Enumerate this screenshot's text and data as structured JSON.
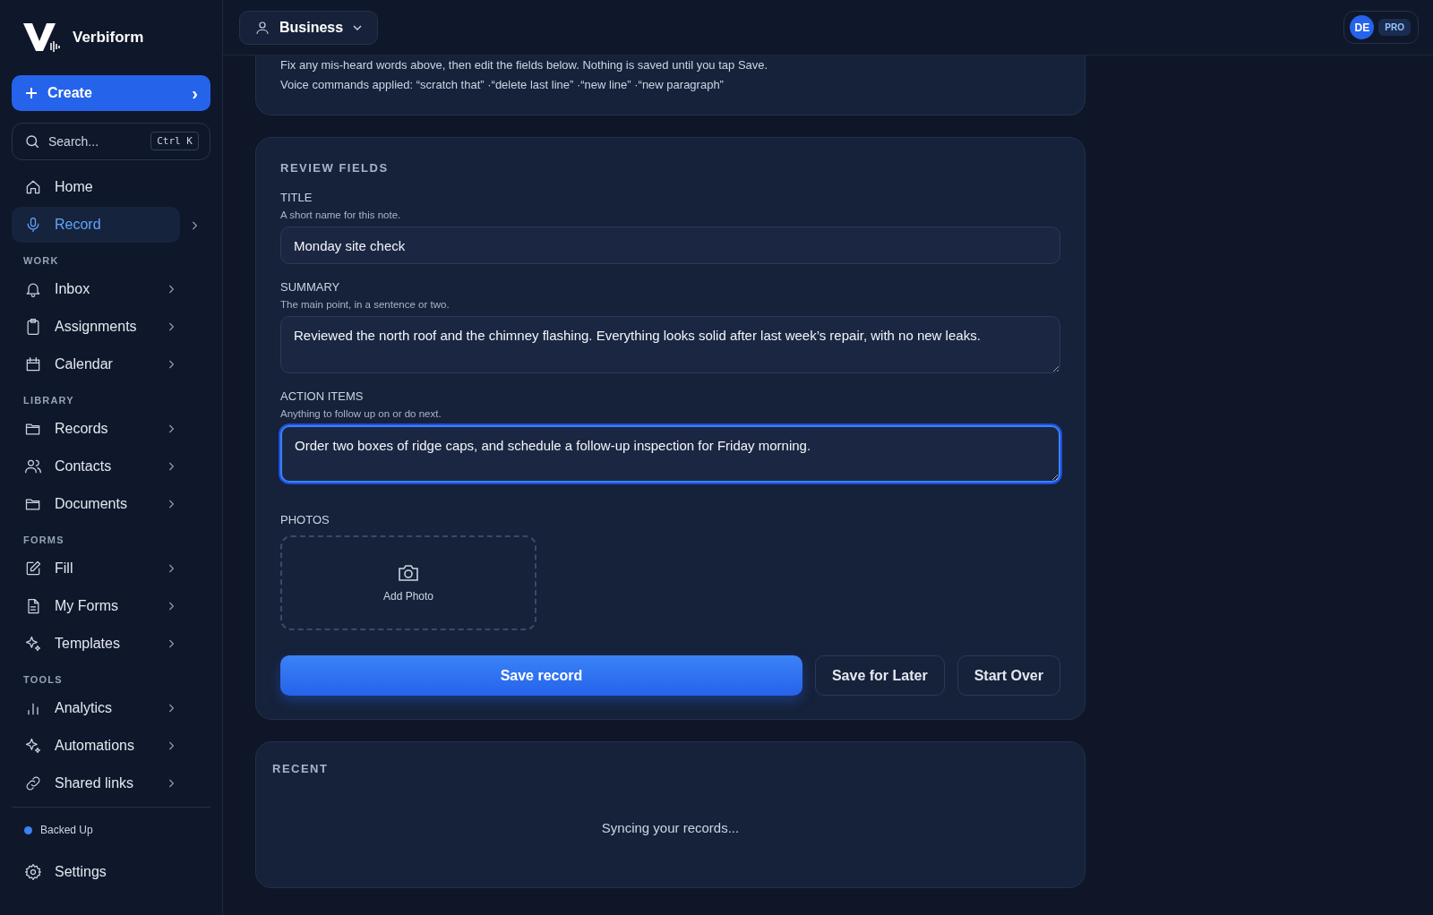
{
  "brand": {
    "name": "Verbiform"
  },
  "create_button": {
    "label": "Create",
    "chevron": "›"
  },
  "search": {
    "placeholder": "Search...",
    "shortcut": "Ctrl K"
  },
  "nav_top": [
    {
      "label": "Home",
      "selected": false,
      "chevron": false
    },
    {
      "label": "Record",
      "selected": true,
      "chevron": true
    }
  ],
  "nav_sections": [
    {
      "title": "WORK",
      "items": [
        {
          "label": "Inbox",
          "selected": false,
          "chevron": true
        },
        {
          "label": "Assignments",
          "selected": false,
          "chevron": true
        },
        {
          "label": "Calendar",
          "selected": false,
          "chevron": true
        }
      ]
    },
    {
      "title": "LIBRARY",
      "items": [
        {
          "label": "Records",
          "selected": false,
          "chevron": true
        },
        {
          "label": "Contacts",
          "selected": false,
          "chevron": true
        },
        {
          "label": "Documents",
          "selected": false,
          "chevron": true
        }
      ]
    },
    {
      "title": "FORMS",
      "items": [
        {
          "label": "Fill",
          "selected": false,
          "chevron": true
        },
        {
          "label": "My Forms",
          "selected": false,
          "chevron": true
        },
        {
          "label": "Templates",
          "selected": false,
          "chevron": true
        }
      ]
    },
    {
      "title": "TOOLS",
      "items": [
        {
          "label": "Analytics",
          "selected": false,
          "chevron": true
        },
        {
          "label": "Automations",
          "selected": false,
          "chevron": true
        },
        {
          "label": "Shared links",
          "selected": false,
          "chevron": true
        }
      ]
    }
  ],
  "status": {
    "label": "Backed Up",
    "color": "#3b82f6"
  },
  "settings": {
    "label": "Settings"
  },
  "header": {
    "workspace": "Business",
    "avatar": "DE",
    "plan": "PRO"
  },
  "notes": [
    "Fix any mis-heard words above, then edit the fields below. Nothing is saved until you tap Save.",
    "Voice commands applied: “scratch that” ·“delete last line” ·“new line” ·“new paragraph”"
  ],
  "review": {
    "title": "REVIEW FIELDS",
    "fields": [
      {
        "kind": "input",
        "label": "TITLE",
        "hint": "A short name for this note.",
        "value": "Monday site check",
        "focused": false
      },
      {
        "kind": "textarea",
        "label": "SUMMARY",
        "hint": "The main point, in a sentence or two.",
        "value": "Reviewed the north roof and the chimney flashing. Everything looks solid after last week’s repair, with no new leaks.",
        "focused": false
      },
      {
        "kind": "textarea",
        "label": "ACTION ITEMS",
        "hint": "Anything to follow up on or do next.",
        "value": "Order two boxes of ridge caps, and schedule a follow-up inspection for Friday morning.",
        "focused": true
      }
    ],
    "photos": {
      "label": "PHOTOS",
      "add": "Add Photo"
    },
    "buttons": [
      {
        "kind": "primary",
        "label": "Save record"
      },
      {
        "kind": "secondary",
        "label": "Save for Later"
      },
      {
        "kind": "secondary",
        "label": "Start Over"
      }
    ]
  },
  "recent": {
    "title": "RECENT",
    "message": "Syncing your records..."
  }
}
